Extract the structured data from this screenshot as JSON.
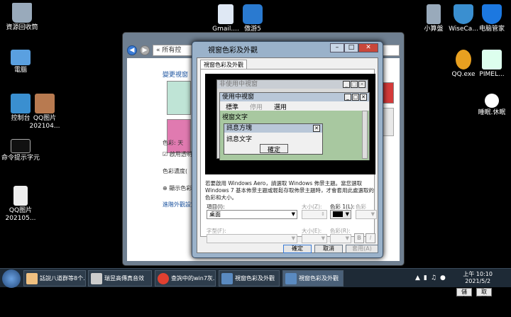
{
  "desktop_icons": [
    {
      "label": "資源回收筒",
      "name": "recycle-bin",
      "color": "#9ab"
    },
    {
      "label": "電腦",
      "name": "computer",
      "color": "#5aa0e0"
    },
    {
      "label": "控制台",
      "name": "control-panel",
      "color": "#3a8fd0"
    },
    {
      "label": "QQ图片202104...",
      "name": "qq-image-1",
      "color": "#b87a50"
    },
    {
      "label": "命令提示字元",
      "name": "command-prompt",
      "color": "#222"
    },
    {
      "label": "QQ图片202105...",
      "name": "qq-image-2",
      "color": "#eee"
    },
    {
      "label": "Gmail....",
      "name": "gmail",
      "color": "#dfe8f4"
    },
    {
      "label": "傲游5",
      "name": "maxthon",
      "color": "#2a7ad0"
    },
    {
      "label": "小算盤",
      "name": "calculator",
      "color": "#9ab"
    },
    {
      "label": "WiseCa...",
      "name": "wisecare",
      "color": "#3a8fd0"
    },
    {
      "label": "电脑管家",
      "name": "pc-manager",
      "color": "#1c78e0"
    },
    {
      "label": "QQ.exe",
      "name": "qq-exe",
      "color": "#000"
    },
    {
      "label": "PIMEL...",
      "name": "pimel",
      "color": "#dfe"
    },
    {
      "label": "睡眠.休眠",
      "name": "sleep",
      "color": "#fff"
    }
  ],
  "back_window": {
    "address": "« 所有控",
    "heading": "變更視窗",
    "color_label": "色彩: 天",
    "transparency_label": "啟用透明效",
    "intensity_label": "色彩濃度(",
    "mixer_label": "顯示色彩",
    "advanced_link": "進階外觀設定",
    "save_label": "儲存變更",
    "cancel_label": "取消"
  },
  "dialog": {
    "title": "視窗色彩及外觀",
    "tab": "視窗色彩及外觀",
    "preview": {
      "inactive_title": "非使用中視窗",
      "active_title": "使用中視窗",
      "menu": [
        "標準",
        "停用",
        "選用"
      ],
      "window_text": "視窗文字",
      "msgbox_title": "訊息方塊",
      "msgbox_text": "訊息文字",
      "ok": "確定"
    },
    "description": "若要啟用 Windows Aero，請選取 Windows 佈景主題。當您選取 Windows 7 基本佈景主題或輕鬆存取佈景主題時，才會套用此處選取的色彩和大小。",
    "item_label": "項目(I):",
    "item_value": "桌面",
    "size_label": "大小(Z):",
    "color1_label": "色彩 1(L):",
    "color2_label": "色彩 2(2):",
    "font_label": "字型(F):",
    "font_size_label": "大小(E):",
    "font_color_label": "色彩(R):",
    "bold": "B",
    "italic": "I",
    "ok": "確定",
    "cancel": "取消",
    "apply": "套用(A)"
  },
  "taskbar": {
    "items": [
      {
        "label": "話說八道群等8个...",
        "color": "#f0c080"
      },
      {
        "label": "瑞昱高傳真音效",
        "color": "#ccc"
      },
      {
        "label": "查詢中的win7灰...",
        "color": "#e04030"
      },
      {
        "label": "視窗色彩及外觀",
        "color": "#5a8ac0"
      },
      {
        "label": "視窗色彩及外觀",
        "color": "#5a8ac0"
      }
    ],
    "time": "上午 10:10",
    "date": "2021/5/2"
  }
}
